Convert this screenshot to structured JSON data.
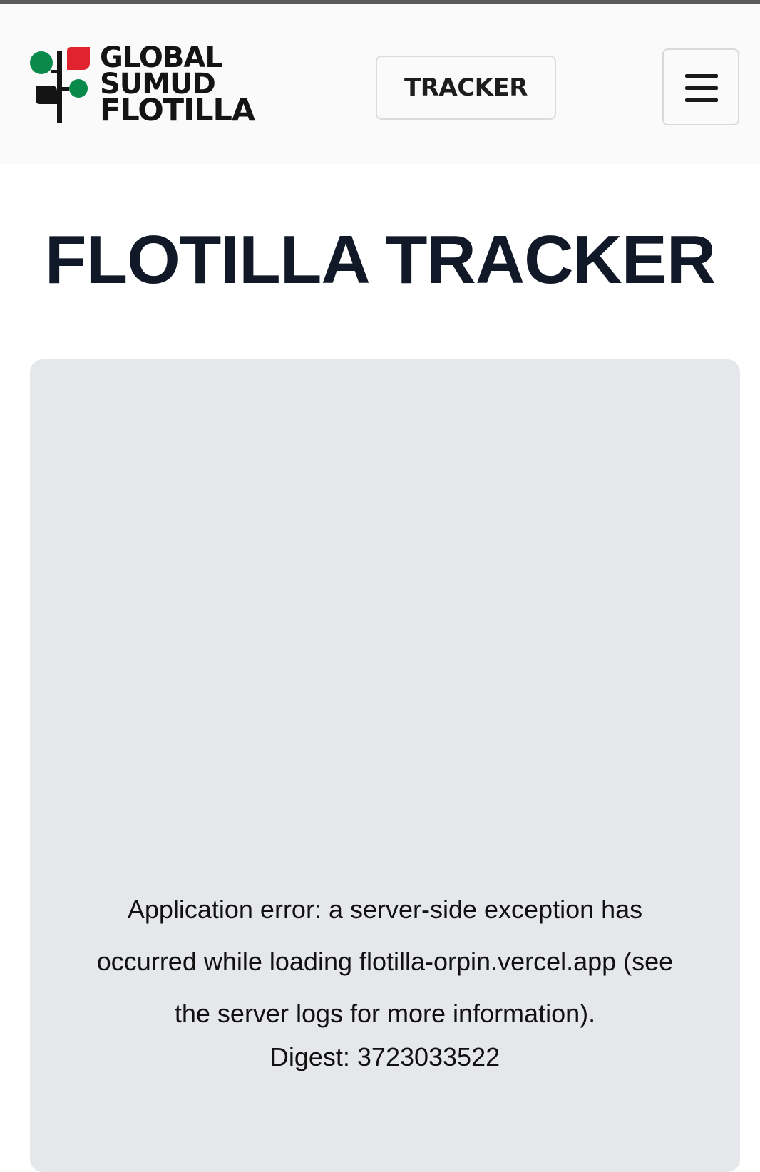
{
  "header": {
    "logo_lines": [
      "GLOBAL",
      "SUMUD",
      "FLOTILLA"
    ],
    "tracker_button_label": "TRACKER",
    "menu_icon": "hamburger-menu-icon",
    "logo_colors": {
      "green": "#0a8a4a",
      "red": "#e0232e",
      "black": "#141414"
    }
  },
  "main": {
    "title": "FLOTILLA TRACKER",
    "error": {
      "message": "Application error: a server-side exception has occurred while loading flotilla-orpin.vercel.app (see the server logs for more information).",
      "digest": "Digest: 3723033522"
    }
  }
}
